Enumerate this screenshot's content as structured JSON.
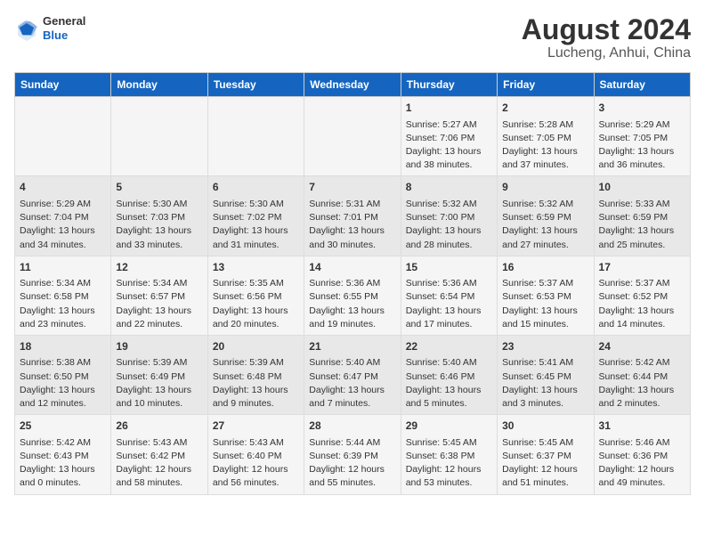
{
  "header": {
    "logo_general": "General",
    "logo_blue": "Blue",
    "title": "August 2024",
    "subtitle": "Lucheng, Anhui, China"
  },
  "days_of_week": [
    "Sunday",
    "Monday",
    "Tuesday",
    "Wednesday",
    "Thursday",
    "Friday",
    "Saturday"
  ],
  "weeks": [
    [
      {
        "day": "",
        "content": ""
      },
      {
        "day": "",
        "content": ""
      },
      {
        "day": "",
        "content": ""
      },
      {
        "day": "",
        "content": ""
      },
      {
        "day": "1",
        "content": "Sunrise: 5:27 AM\nSunset: 7:06 PM\nDaylight: 13 hours\nand 38 minutes."
      },
      {
        "day": "2",
        "content": "Sunrise: 5:28 AM\nSunset: 7:05 PM\nDaylight: 13 hours\nand 37 minutes."
      },
      {
        "day": "3",
        "content": "Sunrise: 5:29 AM\nSunset: 7:05 PM\nDaylight: 13 hours\nand 36 minutes."
      }
    ],
    [
      {
        "day": "4",
        "content": "Sunrise: 5:29 AM\nSunset: 7:04 PM\nDaylight: 13 hours\nand 34 minutes."
      },
      {
        "day": "5",
        "content": "Sunrise: 5:30 AM\nSunset: 7:03 PM\nDaylight: 13 hours\nand 33 minutes."
      },
      {
        "day": "6",
        "content": "Sunrise: 5:30 AM\nSunset: 7:02 PM\nDaylight: 13 hours\nand 31 minutes."
      },
      {
        "day": "7",
        "content": "Sunrise: 5:31 AM\nSunset: 7:01 PM\nDaylight: 13 hours\nand 30 minutes."
      },
      {
        "day": "8",
        "content": "Sunrise: 5:32 AM\nSunset: 7:00 PM\nDaylight: 13 hours\nand 28 minutes."
      },
      {
        "day": "9",
        "content": "Sunrise: 5:32 AM\nSunset: 6:59 PM\nDaylight: 13 hours\nand 27 minutes."
      },
      {
        "day": "10",
        "content": "Sunrise: 5:33 AM\nSunset: 6:59 PM\nDaylight: 13 hours\nand 25 minutes."
      }
    ],
    [
      {
        "day": "11",
        "content": "Sunrise: 5:34 AM\nSunset: 6:58 PM\nDaylight: 13 hours\nand 23 minutes."
      },
      {
        "day": "12",
        "content": "Sunrise: 5:34 AM\nSunset: 6:57 PM\nDaylight: 13 hours\nand 22 minutes."
      },
      {
        "day": "13",
        "content": "Sunrise: 5:35 AM\nSunset: 6:56 PM\nDaylight: 13 hours\nand 20 minutes."
      },
      {
        "day": "14",
        "content": "Sunrise: 5:36 AM\nSunset: 6:55 PM\nDaylight: 13 hours\nand 19 minutes."
      },
      {
        "day": "15",
        "content": "Sunrise: 5:36 AM\nSunset: 6:54 PM\nDaylight: 13 hours\nand 17 minutes."
      },
      {
        "day": "16",
        "content": "Sunrise: 5:37 AM\nSunset: 6:53 PM\nDaylight: 13 hours\nand 15 minutes."
      },
      {
        "day": "17",
        "content": "Sunrise: 5:37 AM\nSunset: 6:52 PM\nDaylight: 13 hours\nand 14 minutes."
      }
    ],
    [
      {
        "day": "18",
        "content": "Sunrise: 5:38 AM\nSunset: 6:50 PM\nDaylight: 13 hours\nand 12 minutes."
      },
      {
        "day": "19",
        "content": "Sunrise: 5:39 AM\nSunset: 6:49 PM\nDaylight: 13 hours\nand 10 minutes."
      },
      {
        "day": "20",
        "content": "Sunrise: 5:39 AM\nSunset: 6:48 PM\nDaylight: 13 hours\nand 9 minutes."
      },
      {
        "day": "21",
        "content": "Sunrise: 5:40 AM\nSunset: 6:47 PM\nDaylight: 13 hours\nand 7 minutes."
      },
      {
        "day": "22",
        "content": "Sunrise: 5:40 AM\nSunset: 6:46 PM\nDaylight: 13 hours\nand 5 minutes."
      },
      {
        "day": "23",
        "content": "Sunrise: 5:41 AM\nSunset: 6:45 PM\nDaylight: 13 hours\nand 3 minutes."
      },
      {
        "day": "24",
        "content": "Sunrise: 5:42 AM\nSunset: 6:44 PM\nDaylight: 13 hours\nand 2 minutes."
      }
    ],
    [
      {
        "day": "25",
        "content": "Sunrise: 5:42 AM\nSunset: 6:43 PM\nDaylight: 13 hours\nand 0 minutes."
      },
      {
        "day": "26",
        "content": "Sunrise: 5:43 AM\nSunset: 6:42 PM\nDaylight: 12 hours\nand 58 minutes."
      },
      {
        "day": "27",
        "content": "Sunrise: 5:43 AM\nSunset: 6:40 PM\nDaylight: 12 hours\nand 56 minutes."
      },
      {
        "day": "28",
        "content": "Sunrise: 5:44 AM\nSunset: 6:39 PM\nDaylight: 12 hours\nand 55 minutes."
      },
      {
        "day": "29",
        "content": "Sunrise: 5:45 AM\nSunset: 6:38 PM\nDaylight: 12 hours\nand 53 minutes."
      },
      {
        "day": "30",
        "content": "Sunrise: 5:45 AM\nSunset: 6:37 PM\nDaylight: 12 hours\nand 51 minutes."
      },
      {
        "day": "31",
        "content": "Sunrise: 5:46 AM\nSunset: 6:36 PM\nDaylight: 12 hours\nand 49 minutes."
      }
    ]
  ]
}
